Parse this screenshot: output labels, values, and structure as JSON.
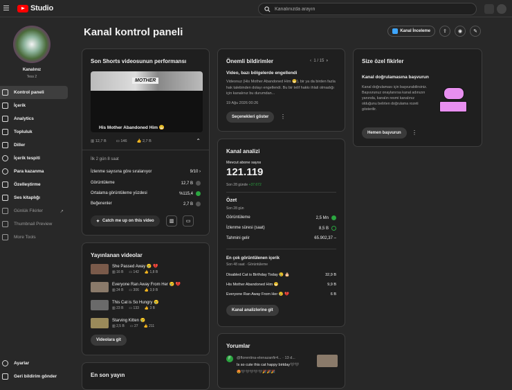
{
  "app": {
    "title": "Studio",
    "search_placeholder": "Kanalınızda arayın"
  },
  "channel": {
    "name": "Kanalınız",
    "subtitle": "Tess 2"
  },
  "nav": [
    {
      "label": "Kontrol paneli"
    },
    {
      "label": "İçerik"
    },
    {
      "label": "Analytics"
    },
    {
      "label": "Topluluk"
    },
    {
      "label": "Diller"
    },
    {
      "label": "İçerik tespiti"
    },
    {
      "label": "Para kazanma"
    },
    {
      "label": "Özelleştirme"
    },
    {
      "label": "Ses kitaplığı"
    },
    {
      "label": "Günlük Fikirler"
    },
    {
      "label": "Thumbnail Preview"
    },
    {
      "label": "More Tools"
    }
  ],
  "bottom_nav": [
    {
      "label": "Ayarlar"
    },
    {
      "label": "Geri bildirim gönder"
    }
  ],
  "header": {
    "title": "Kanal kontrol paneli",
    "review_label": "Kanal İnceleme"
  },
  "shorts": {
    "title": "Son Shorts videosunun performansı",
    "thumb_text": "MOTHER",
    "video_title": "His Mother Abandoned Him 😁",
    "views": "12,7 B",
    "comments": "146",
    "likes": "2,7 B",
    "period": "İlk 2 gün 8 saat",
    "rows": [
      {
        "label": "İzlenme sayısına göre sıralanıyor",
        "value": "9/10"
      },
      {
        "label": "Görüntüleme",
        "value": "12,7 B"
      },
      {
        "label": "Ortalama görüntüleme yüzdesi",
        "value": "%115,4"
      },
      {
        "label": "Beğenenler",
        "value": "2,7 B"
      }
    ],
    "cta": "Catch me up on this video"
  },
  "published": {
    "title": "Yayınlanan videolar",
    "videos": [
      {
        "title": "She Passed Away 😢 💔",
        "v": "16 B",
        "c": "142",
        "l": "1,8 B"
      },
      {
        "title": "Everyone Ran Away From Her 😢 💔",
        "v": "24 B",
        "c": "306",
        "l": "3,9 B"
      },
      {
        "title": "This Cat is So Hungry 😢",
        "v": "23 B",
        "c": "133",
        "l": "3 B"
      },
      {
        "title": "Starving Kitten 😢",
        "v": "2,5 B",
        "c": "27",
        "l": "211"
      }
    ],
    "btn": "Videolara git"
  },
  "latest": {
    "title": "En son yayın"
  },
  "notices": {
    "title": "Önemli bildirimler",
    "pager": "1 / 15",
    "heading": "Video, bazı bölgelerde engellendi",
    "body": "Videonuz (His Mother Abandoned Him 😁), bir ya da birden fazla hak talebinden dolayı engellendi. Bu bir telif hakkı ihlali olmadığı için kanalınız bu durumdan...",
    "date": "19 Ağu 2026 00:26",
    "btn": "Seçenekleri göster"
  },
  "analytics": {
    "title": "Kanal analizi",
    "subs_label": "Mevcut abone sayısı",
    "subs": "121.119",
    "subs_change_label": "Son 28 günde",
    "subs_change": "+37.672",
    "summary_title": "Özet",
    "summary_sub": "Son 28 gün",
    "rows": [
      {
        "label": "Görüntüleme",
        "value": "2,5 Mn"
      },
      {
        "label": "İzlenme süresi (saat)",
        "value": "8,5 B"
      },
      {
        "label": "Tahmini gelir",
        "value": "65.902,37"
      }
    ],
    "top_title": "En çok görüntülenen içerik",
    "top_sub": "Son 48 saat · Görüntüleme",
    "top": [
      {
        "label": "Disabled Cat is Birthday Today 😢 🎂",
        "value": "32,9 B"
      },
      {
        "label": "His Mother Abandoned Him 😁",
        "value": "9,9 B"
      },
      {
        "label": "Everyone Ran Away From Her 😢 💔",
        "value": "6 B"
      }
    ],
    "btn": "Kanal analizlerine git"
  },
  "ideas": {
    "title": "Size özel fikirler",
    "heading": "Kanal doğrulamasına başvurun",
    "body": "Kanal doğrulaması için başvurabilirsiniz. Başvurunuz onaylanırsa kanal adınızın yanında, kanalın resmi kanalınız olduğunu belirten doğrulama rozeti gösterilir.",
    "btn": "Hemen başvurun"
  },
  "comments": {
    "title": "Yorumlar",
    "author": "@florentina-elenazanfir4...",
    "time": "· 13 d...",
    "text": "Is so cute this cat happy birtday🖤🖤",
    "emojis": "😍🖤🖤🖤🖤🖤🎉🎉🎉"
  },
  "colors": {
    "brand": "#ff0000",
    "positive": "#2ba640",
    "accent": "#3ea6ff"
  }
}
